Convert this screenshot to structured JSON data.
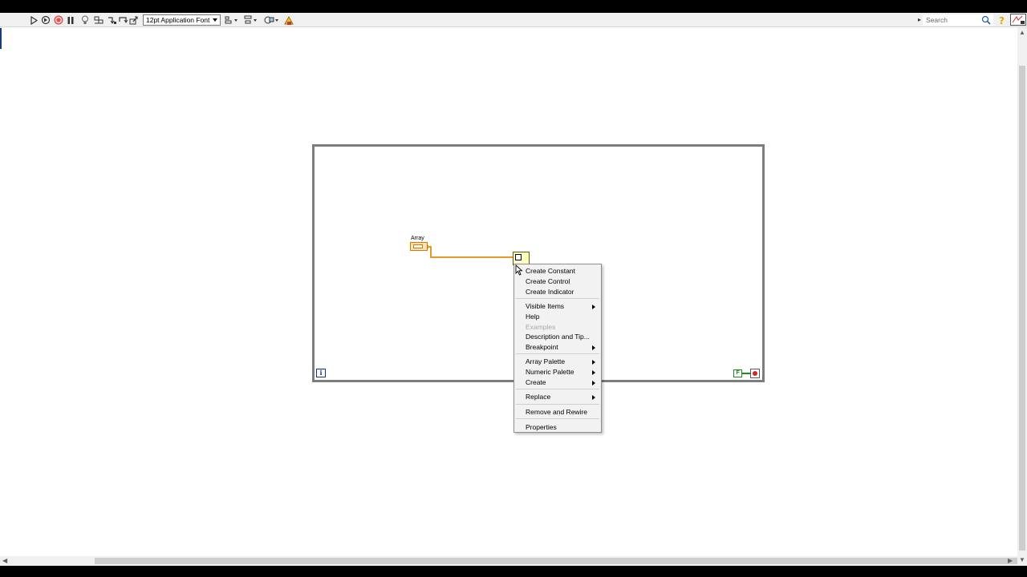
{
  "toolbar": {
    "font_select_value": "12pt Application Font",
    "search_placeholder": "Search",
    "tools": [
      "run-arrow-icon",
      "run-continuously-icon",
      "abort-icon",
      "pause-icon",
      "highlight-execution-icon",
      "retain-wire-values-icon",
      "step-into-icon",
      "step-over-icon",
      "step-out-icon",
      "align-objects-icon",
      "distribute-objects-icon",
      "reorder-icon",
      "cleanup-diagram-icon"
    ],
    "help_icon": "help-icon",
    "search_icon": "magnifier-icon"
  },
  "diagram": {
    "loop_type": "while-loop",
    "iteration_terminal_label": "i",
    "condition_constant_label": "F",
    "array_label": "Array",
    "colors": {
      "array_wire": "#e49a28",
      "loop_border": "#7d7d7d",
      "condition_green": "#1c8a1c",
      "stop_red": "#d8231c",
      "iteration_blue": "#1b2f8a"
    }
  },
  "context_menu": {
    "items": [
      {
        "label": "Create Constant",
        "submenu": false,
        "disabled": false
      },
      {
        "label": "Create Control",
        "submenu": false,
        "disabled": false
      },
      {
        "label": "Create Indicator",
        "submenu": false,
        "disabled": false
      },
      {
        "label": "Visible Items",
        "submenu": true,
        "disabled": false
      },
      {
        "label": "Help",
        "submenu": false,
        "disabled": false
      },
      {
        "label": "Examples",
        "submenu": false,
        "disabled": true
      },
      {
        "label": "Description and Tip...",
        "submenu": false,
        "disabled": false
      },
      {
        "label": "Breakpoint",
        "submenu": true,
        "disabled": false
      },
      {
        "label": "Array Palette",
        "submenu": true,
        "disabled": false
      },
      {
        "label": "Numeric Palette",
        "submenu": true,
        "disabled": false
      },
      {
        "label": "Create",
        "submenu": true,
        "disabled": false
      },
      {
        "label": "Replace",
        "submenu": true,
        "disabled": false
      },
      {
        "label": "Remove and Rewire",
        "submenu": false,
        "disabled": false
      },
      {
        "label": "Properties",
        "submenu": false,
        "disabled": false
      }
    ]
  }
}
